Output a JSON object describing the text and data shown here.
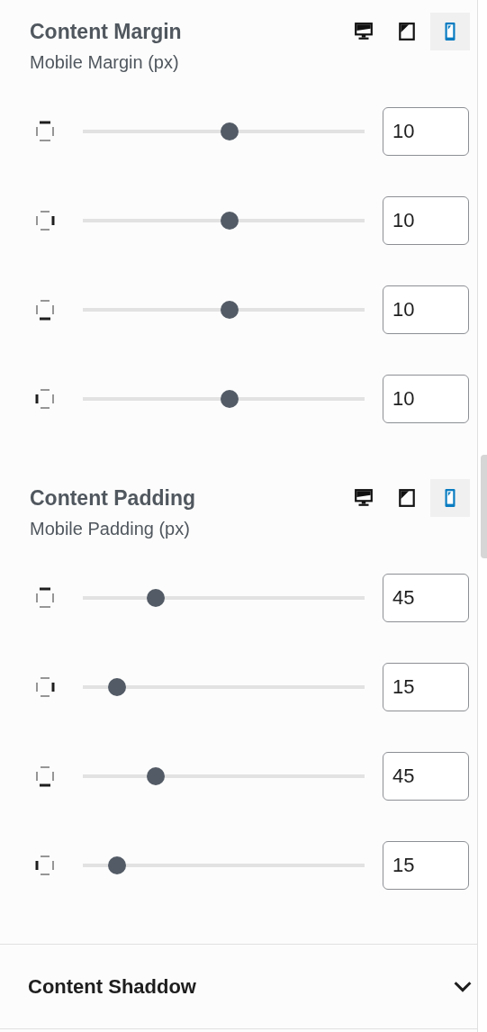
{
  "sections": [
    {
      "title": "Content Margin",
      "subtitle": "Mobile Margin (px)",
      "devices": [
        {
          "kind": "desktop",
          "selected": false
        },
        {
          "kind": "tablet",
          "selected": false
        },
        {
          "kind": "mobile",
          "selected": true
        }
      ],
      "rows": [
        {
          "kind": "top",
          "level": 0.52,
          "value": "10"
        },
        {
          "kind": "right",
          "level": 0.52,
          "value": "10"
        },
        {
          "kind": "bottom",
          "level": 0.52,
          "value": "10"
        },
        {
          "kind": "left",
          "level": 0.52,
          "value": "10"
        }
      ]
    },
    {
      "title": "Content Padding",
      "subtitle": "Mobile Padding (px)",
      "devices": [
        {
          "kind": "desktop",
          "selected": false
        },
        {
          "kind": "tablet",
          "selected": false
        },
        {
          "kind": "mobile",
          "selected": true
        }
      ],
      "rows": [
        {
          "kind": "top",
          "level": 0.26,
          "value": "45"
        },
        {
          "kind": "right",
          "level": 0.12,
          "value": "15"
        },
        {
          "kind": "bottom",
          "level": 0.26,
          "value": "45"
        },
        {
          "kind": "left",
          "level": 0.12,
          "value": "15"
        }
      ]
    }
  ],
  "collapsed_panel": {
    "title": "Content Shaddow",
    "expanded": false
  }
}
